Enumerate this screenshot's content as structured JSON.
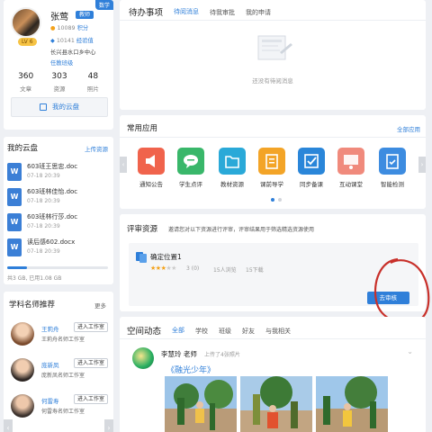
{
  "profile": {
    "name": "张莺",
    "role": "教师",
    "corner_tag": "数学",
    "level": "LV 6",
    "points": "10089",
    "points_label": "积分",
    "exp": "10141",
    "exp_label": "经验值",
    "school": "长兴县水口乡中心",
    "class_link": "任教班级",
    "stats": [
      {
        "num": "360",
        "label": "文章"
      },
      {
        "num": "303",
        "label": "资源"
      },
      {
        "num": "48",
        "label": "照片"
      }
    ],
    "cloud_button": "我的云盘"
  },
  "mycloud": {
    "title": "我的云盘",
    "upload": "上传资源",
    "files": [
      {
        "name": "603班王思忠.doc",
        "date": "07-18  20:39"
      },
      {
        "name": "603班林佳怡.doc",
        "date": "07-18  20:39"
      },
      {
        "name": "603班林行莎.doc",
        "date": "07-18  20:39"
      },
      {
        "name": "读后感602.docx",
        "date": "07-18  20:39"
      }
    ],
    "quota_fraction": 0.2,
    "quota_text": "共3 GB, 已用1.08 GB"
  },
  "teachers": {
    "title": "学科名师推荐",
    "more": "更多",
    "list": [
      {
        "name": "王莉舟",
        "room": "王莉舟名师工作室",
        "btn": "进入工作室",
        "color": "#c7774f"
      },
      {
        "name": "庞新凤",
        "room": "庞新凤名师工作室",
        "btn": "进入工作室",
        "color": "#8c6a52"
      },
      {
        "name": "何雷寿",
        "room": "何雷寿名师工作室",
        "btn": "进入工作室",
        "color": "#6b5a4e"
      }
    ]
  },
  "todo": {
    "title": "待办事项",
    "tabs": [
      "待阅消息",
      "待我审批",
      "我的申请"
    ],
    "empty": "还没有待阅消息"
  },
  "apps": {
    "title": "常用应用",
    "all": "全部应用",
    "items": [
      {
        "label": "通知公告",
        "color": "#f0634c",
        "icon": "megaphone-icon"
      },
      {
        "label": "学生点评",
        "color": "#39b76a",
        "icon": "chat-bubble-icon"
      },
      {
        "label": "教材资源",
        "color": "#2aa9d8",
        "icon": "folder-icon"
      },
      {
        "label": "课前导学",
        "color": "#f3a427",
        "icon": "notebook-icon"
      },
      {
        "label": "同步备课",
        "color": "#2a86d9",
        "icon": "edit-check-icon"
      },
      {
        "label": "互动课堂",
        "color": "#f08a7c",
        "icon": "classroom-icon"
      },
      {
        "label": "智能检测",
        "color": "#3d8ce0",
        "icon": "clipboard-icon"
      }
    ]
  },
  "review": {
    "title": "评审资源",
    "desc": "邀请您对以下资源进行评审，评审结果用于筛选精选资源使用",
    "item_name": "确定位置1",
    "rating": 3,
    "score": "3 (0)",
    "views": "15人浏览",
    "downloads": "15下载",
    "button": "去审核"
  },
  "space": {
    "title": "空间动态",
    "tabs": [
      "全部",
      "学校",
      "班级",
      "好友",
      "与我相关"
    ],
    "author": "李慧玲 老师",
    "meta": "上传了4张照片",
    "post_title": "《融光少年》"
  }
}
